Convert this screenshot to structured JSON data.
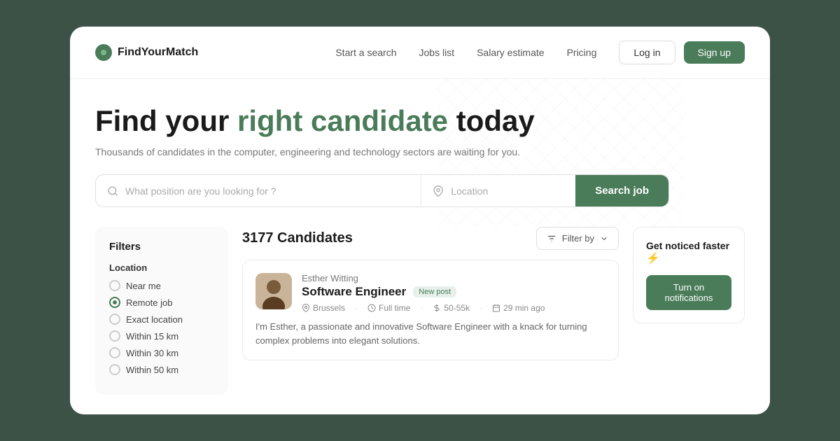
{
  "brand": {
    "name": "FindYourMatch",
    "logo_icon": "circle-icon"
  },
  "nav": {
    "links": [
      {
        "label": "Start a search",
        "id": "start-search"
      },
      {
        "label": "Jobs list",
        "id": "jobs-list"
      },
      {
        "label": "Salary estimate",
        "id": "salary-estimate"
      },
      {
        "label": "Pricing",
        "id": "pricing"
      }
    ],
    "login_label": "Log in",
    "signup_label": "Sign up"
  },
  "hero": {
    "title_before": "Find your ",
    "title_accent": "right candidate",
    "title_after": " today",
    "subtitle": "Thousands of candidates in the computer, engineering and technology sectors are waiting for you.",
    "search_placeholder": "What position are you looking for ?",
    "location_placeholder": "Location",
    "search_button": "Search job"
  },
  "filters": {
    "title": "Filters",
    "location_group": "Location",
    "options": [
      {
        "label": "Near me",
        "checked": false
      },
      {
        "label": "Remote job",
        "checked": true
      },
      {
        "label": "Exact location",
        "checked": false
      },
      {
        "label": "Within 15 km",
        "checked": false
      },
      {
        "label": "Within 30 km",
        "checked": false
      },
      {
        "label": "Within 50 km",
        "checked": false
      }
    ]
  },
  "candidates": {
    "count": "3177 Candidates",
    "filter_label": "Filter by",
    "list": [
      {
        "name": "Esther Witting",
        "title": "Software Engineer",
        "badge": "New post",
        "location": "Brussels",
        "type": "Full time",
        "salary": "50-55k",
        "time": "29 min ago",
        "description": "I'm Esther, a passionate and innovative Software Engineer with a knack for turning complex problems into elegant solutions."
      }
    ]
  },
  "notification": {
    "title": "Get noticed faster",
    "emoji": "⚡",
    "button_label": "Turn on notifications"
  },
  "colors": {
    "accent": "#4a7c59",
    "accent_light": "#e8f0eb"
  }
}
